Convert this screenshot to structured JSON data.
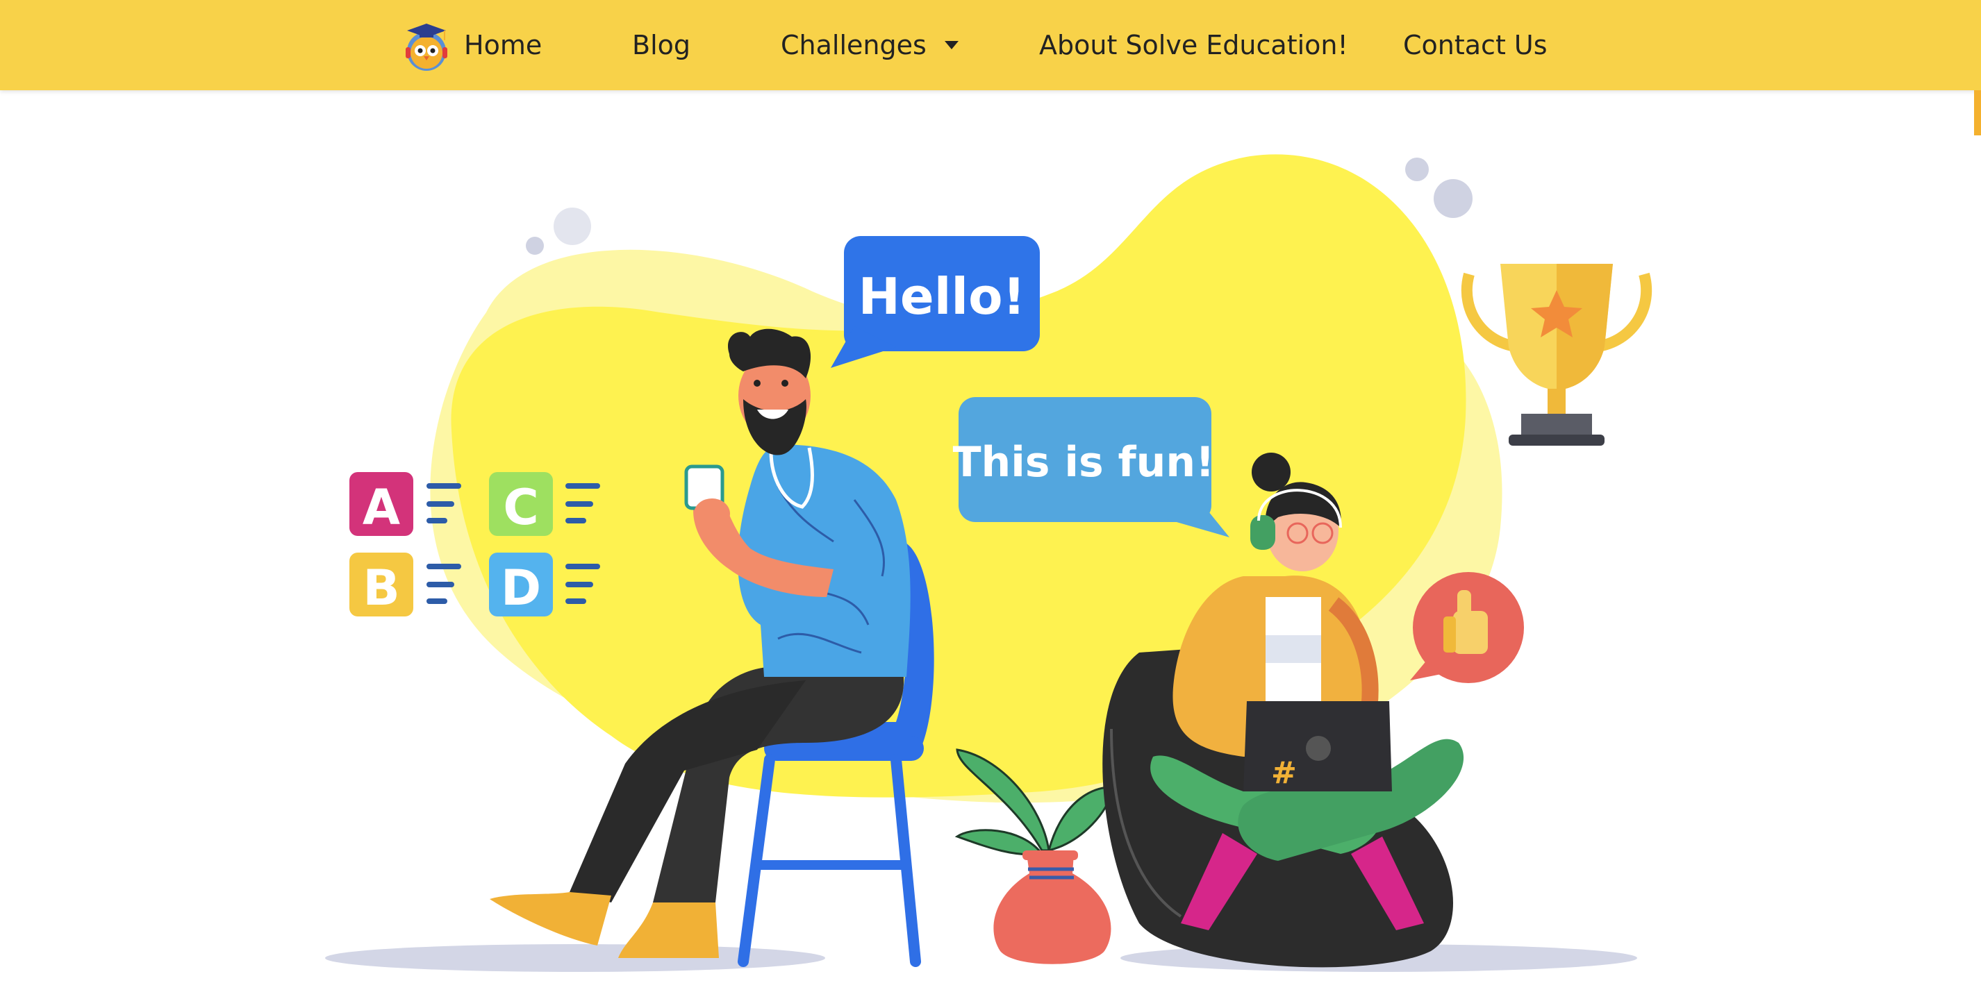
{
  "nav": {
    "items": [
      {
        "label": "Home"
      },
      {
        "label": "Blog"
      },
      {
        "label": "Challenges"
      },
      {
        "label": "About Solve Education!"
      },
      {
        "label": "Contact Us"
      }
    ]
  },
  "hero": {
    "bubble_hello": "Hello!",
    "bubble_fun": "This is fun!",
    "quiz_options": [
      "A",
      "B",
      "C",
      "D"
    ],
    "laptop_symbol": "#"
  },
  "colors": {
    "nav_bg": "#f8d249",
    "blob_yellow": "#fef250",
    "bubble_blue": "#2f74e8",
    "bubble_light_blue": "#53a6de",
    "option_a": "#d3337a",
    "option_b": "#f5c842",
    "option_c": "#9ee060",
    "option_d": "#54b3ee"
  }
}
